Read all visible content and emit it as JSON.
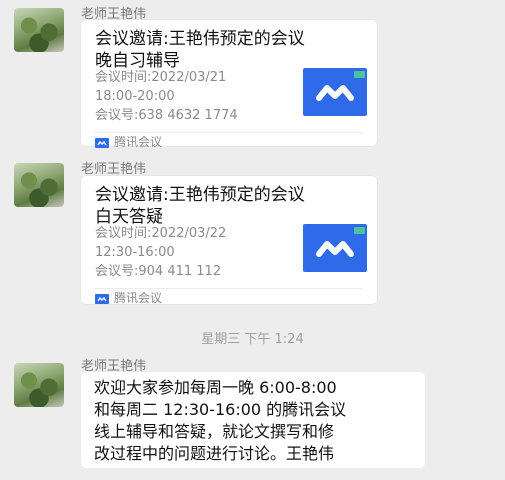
{
  "messages": [
    {
      "sender": "老师王艳伟",
      "card": {
        "title_line1": "会议邀请:王艳伟预定的会议",
        "title_line2": "晚自习辅导",
        "info": [
          "会议时间:2022/03/21",
          "18:00-20:00",
          "会议号:638 4632 1774"
        ],
        "app": "腾讯会议",
        "icon": "tencent-meeting-icon"
      }
    },
    {
      "sender": "老师王艳伟",
      "card": {
        "title_line1": "会议邀请:王艳伟预定的会议",
        "title_line2": "白天答疑",
        "info": [
          "会议时间:2022/03/22",
          "12:30-16:00",
          "会议号:904 411 112"
        ],
        "app": "腾讯会议",
        "icon": "tencent-meeting-icon"
      }
    }
  ],
  "timestamp": "星期三 下午 1:24",
  "text_message": {
    "sender": "老师王艳伟",
    "lines": [
      "欢迎大家参加每周一晚 6:00-8:00",
      "和每周二 12:30-16:00 的腾讯会议",
      "线上辅导和答疑，就论文撰写和修",
      "改过程中的问题进行讨论。王艳伟"
    ]
  },
  "colors": {
    "background": "#ededed",
    "card": "#ffffff",
    "meeting_blue": "#2f6be8"
  }
}
